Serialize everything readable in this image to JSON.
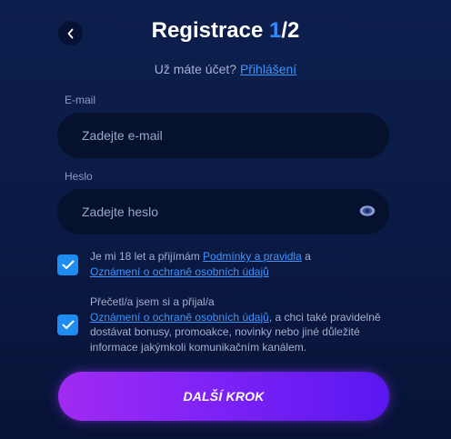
{
  "header": {
    "title_prefix": "Registrace ",
    "step_current": "1",
    "step_suffix": "/2"
  },
  "subtitle": {
    "text": "Už máte účet? ",
    "login_link": "Přihlášení"
  },
  "email": {
    "label": "E-mail",
    "placeholder": "Zadejte e-mail"
  },
  "password": {
    "label": "Heslo",
    "placeholder": "Zadejte heslo"
  },
  "consent_terms": {
    "checked": true,
    "text_before": "Je mi 18 let a přijímám ",
    "link_terms": "Podmínky a pravidla",
    "text_middle": " a",
    "link_privacy": "Oznámení o ochraně osobních údajů"
  },
  "consent_marketing": {
    "checked": true,
    "text_before": "Přečetl/a jsem si a přijal/a",
    "link_privacy": "Oznámení o ochraně osobních údajů",
    "text_after": ", a chci také pravidelně dostávat bonusy, promoakce, novinky nebo jiné důležité informace jakýmkoli komunikačním kanálem."
  },
  "next_button": {
    "label": "DALŠÍ KROK"
  },
  "icons": {
    "back": "chevron-left-icon",
    "eye": "eye-icon",
    "check": "check-icon"
  },
  "colors": {
    "accent": "#2f8cff",
    "checkbox": "#1e8cf0",
    "button_gradient_start": "#a12bf2",
    "button_gradient_end": "#5a17f0"
  }
}
